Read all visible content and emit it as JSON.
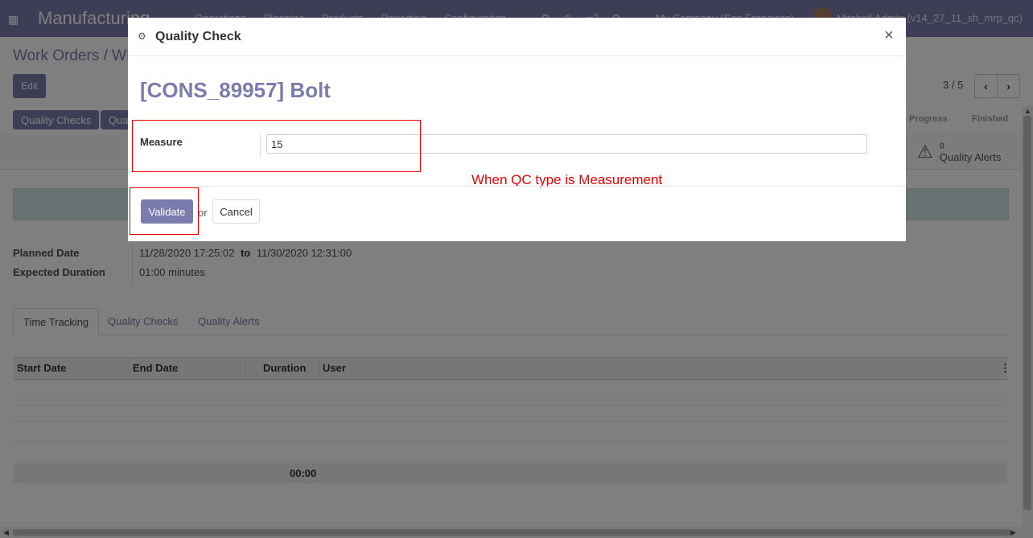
{
  "navbar": {
    "app_name": "Manufacturing",
    "menu": [
      "Operations",
      "Planning",
      "Products",
      "Reporting",
      "Configuration"
    ],
    "message_count": "5",
    "company": "My Company (San Francisco)",
    "user": "Mitchell Admin (v14_27_11_sh_mrp_qc)"
  },
  "breadcrumb": "Work Orders / WH",
  "edit_label": "Edit",
  "pager": "3 / 5",
  "statusbar": {
    "buttons": [
      "Quality Checks",
      "Qua"
    ],
    "stages": [
      "Progress",
      "Finished"
    ]
  },
  "quality_alerts": {
    "count": "0",
    "label": "Quality Alerts"
  },
  "fields": {
    "planned_date_label": "Planned Date",
    "planned_from": "11/28/2020 17:25:02",
    "to": "to",
    "planned_to": "11/30/2020 12:31:00",
    "expected_duration_label": "Expected Duration",
    "expected_duration": "01:00",
    "unit": "minutes"
  },
  "tabs": [
    "Time Tracking",
    "Quality Checks",
    "Quality Alerts"
  ],
  "table": {
    "headers": [
      "Start Date",
      "End Date",
      "Duration",
      "User"
    ],
    "total_duration": "00:00"
  },
  "modal": {
    "title": "Quality Check",
    "product": "[CONS_89957] Bolt",
    "measure_label": "Measure",
    "measure_value": "15",
    "annotation": "When QC type is Measurement",
    "validate": "Validate",
    "or": "or",
    "cancel": "Cancel"
  },
  "colors": {
    "brand": "#7c7bad",
    "annotation": "#e00000"
  }
}
